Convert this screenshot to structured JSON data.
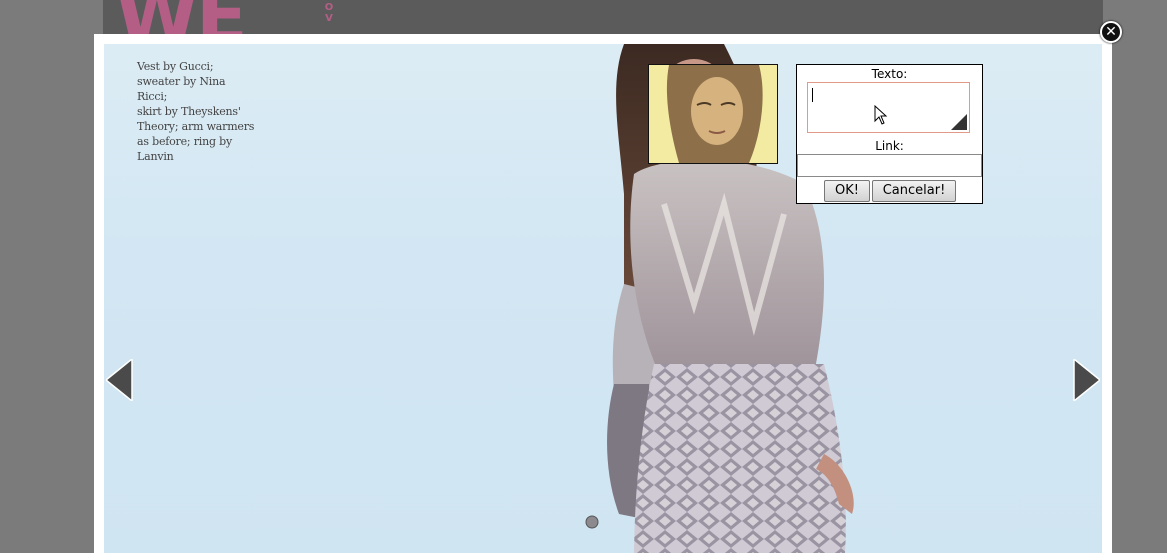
{
  "background_page": {
    "logo_text": "WE",
    "logo_side_letters": [
      "O",
      "V"
    ],
    "brand_color": "#b45e86"
  },
  "lightbox": {
    "photo_credits": "Vest by Gucci;\nsweater by Nina Ricci;\nskirt by Theyskens'\nTheory; arm warmers\nas before; ring by\nLanvin",
    "close_icon": "close-icon",
    "prev_icon": "chevron-left-icon",
    "next_icon": "chevron-right-icon"
  },
  "tag_form": {
    "texto_label": "Texto:",
    "texto_value": "",
    "link_label": "Link:",
    "link_value": "",
    "ok_label": "OK!",
    "cancel_label": "Cancelar!",
    "textarea_border_color": "#e09a87"
  },
  "colors": {
    "overlay": "#7b7b7b",
    "sky": "#d2e7f3",
    "tag_highlight": "#f6f0a9"
  }
}
